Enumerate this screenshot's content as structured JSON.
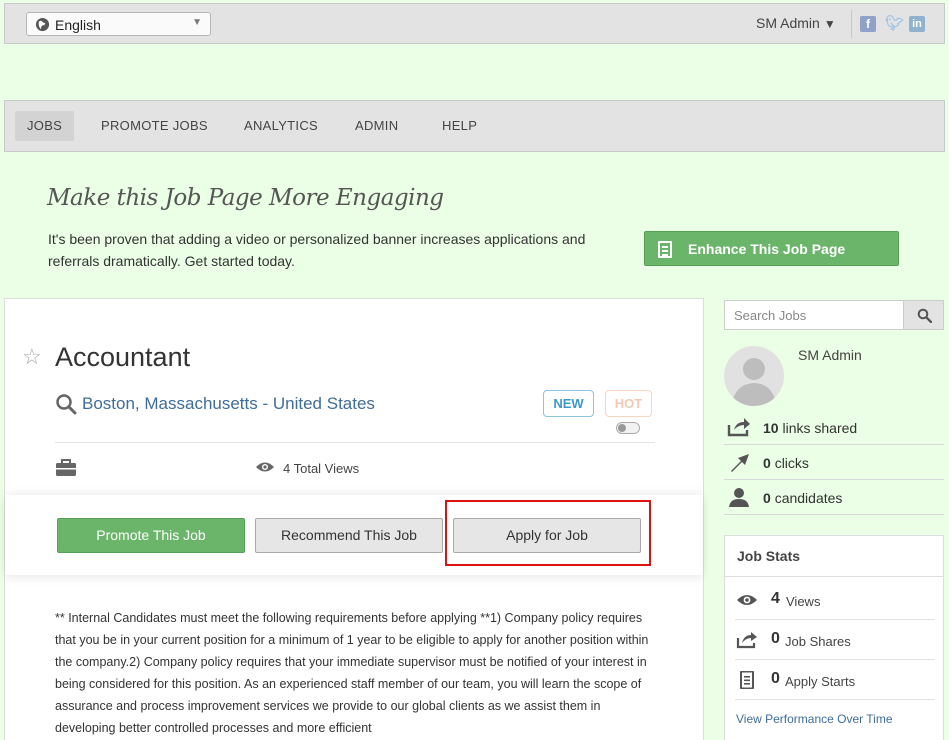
{
  "topbar": {
    "language": "English",
    "user": "SM Admin"
  },
  "nav": {
    "items": [
      "JOBS",
      "PROMOTE JOBS",
      "ANALYTICS",
      "ADMIN",
      "HELP"
    ],
    "active": "JOBS"
  },
  "promo": {
    "title": "Make this Job Page More Engaging",
    "text": "It's been proven that adding a video or personalized banner increases applications and referrals dramatically. Get started today.",
    "button": "Enhance This Job Page"
  },
  "job": {
    "title": "Accountant",
    "location": "Boston, Massachusetts - United States",
    "badge_new": "NEW",
    "badge_hot": "HOT",
    "views": "4 Total Views",
    "promote_label": "Promote This Job",
    "recommend_label": "Recommend This Job",
    "apply_label": "Apply for Job",
    "description": "** Internal Candidates must meet the following requirements before applying **1) Company policy requires that you be in your current position for a minimum of 1 year to be eligible to apply for another position within the company.2) Company policy requires that your immediate supervisor must be notified of your interest in being considered for this position. As an experienced staff member of our team, you will learn the scope of assurance and process improvement services we provide to our global clients as we assist them in developing better controlled processes and more efficient"
  },
  "sidebar": {
    "search_placeholder": "Search Jobs",
    "user_name": "SM Admin",
    "links_shared_count": "10",
    "links_shared_label": "links shared",
    "clicks_count": "0",
    "clicks_label": "clicks",
    "candidates_count": "0",
    "candidates_label": "candidates"
  },
  "job_stats": {
    "title": "Job Stats",
    "views_count": "4",
    "views_label": "Views",
    "shares_count": "0",
    "shares_label": "Job Shares",
    "starts_count": "0",
    "starts_label": "Apply Starts",
    "link": "View Performance Over Time"
  }
}
